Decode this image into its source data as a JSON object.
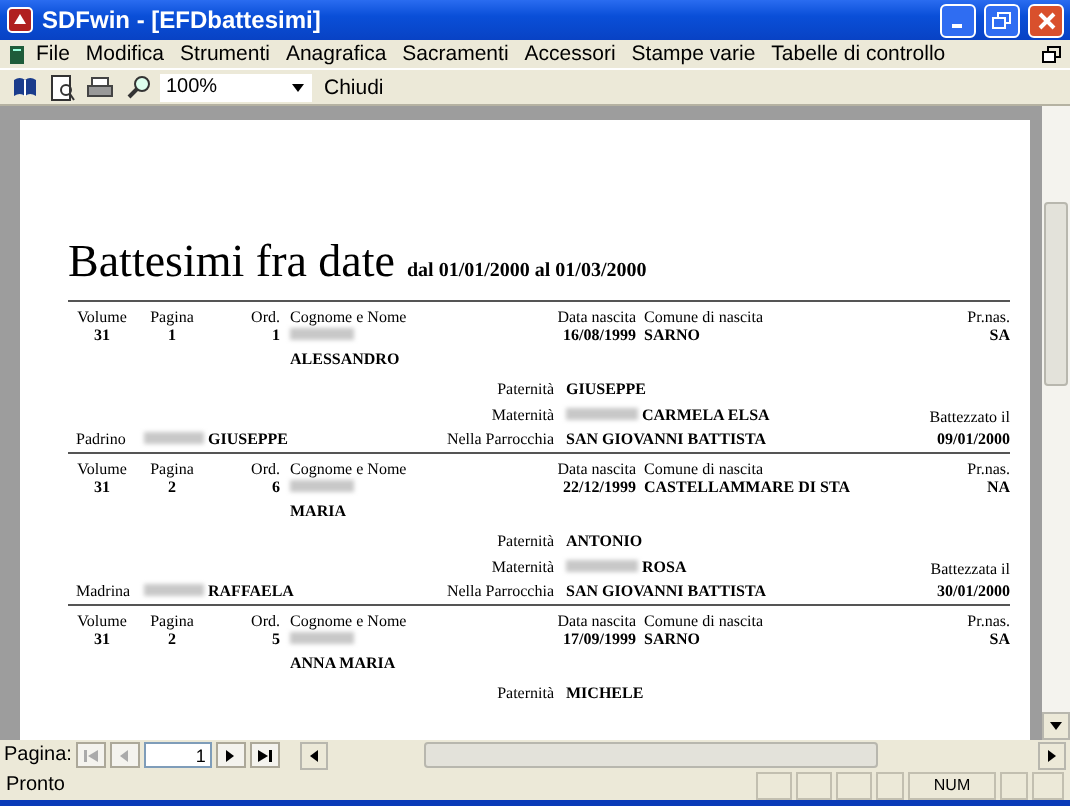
{
  "window": {
    "title": "SDFwin - [EFDbattesimi]"
  },
  "menu": [
    "File",
    "Modifica",
    "Strumenti",
    "Anagrafica",
    "Sacramenti",
    "Accessori",
    "Stampe varie",
    "Tabelle di controllo"
  ],
  "toolbar": {
    "zoom": "100%",
    "close_label": "Chiudi"
  },
  "report": {
    "title": "Battesimi fra date",
    "subtitle": "dal 01/01/2000 al 01/03/2000",
    "records": [
      {
        "volume": {
          "label": "Volume",
          "value": "31"
        },
        "page": {
          "label": "Pagina",
          "value": "1"
        },
        "ord": {
          "label": "Ord.",
          "value": "1"
        },
        "name": {
          "label": "Cognome e Nome",
          "value": "ALESSANDRO"
        },
        "birth_date": {
          "label": "Data nascita",
          "value": "16/08/1999"
        },
        "birthplace": {
          "label": "Comune di nascita",
          "value": "SARNO"
        },
        "province": {
          "label": "Pr.nas.",
          "value": "SA"
        },
        "father": {
          "label": "Paternità",
          "value": "GIUSEPPE"
        },
        "mother": {
          "label": "Maternità",
          "value": "CARMELA ELSA"
        },
        "baptism": {
          "label": "Battezzato il",
          "value": "09/01/2000"
        },
        "sponsor": {
          "label": "Padrino",
          "value": "GIUSEPPE"
        },
        "parish": {
          "label": "Nella Parrocchia",
          "value": "SAN GIOVANNI BATTISTA"
        }
      },
      {
        "volume": {
          "label": "Volume",
          "value": "31"
        },
        "page": {
          "label": "Pagina",
          "value": "2"
        },
        "ord": {
          "label": "Ord.",
          "value": "6"
        },
        "name": {
          "label": "Cognome e Nome",
          "value": "MARIA"
        },
        "birth_date": {
          "label": "Data nascita",
          "value": "22/12/1999"
        },
        "birthplace": {
          "label": "Comune di nascita",
          "value": "CASTELLAMMARE DI STA"
        },
        "province": {
          "label": "Pr.nas.",
          "value": "NA"
        },
        "father": {
          "label": "Paternità",
          "value": "ANTONIO"
        },
        "mother": {
          "label": "Maternità",
          "value": "ROSA"
        },
        "baptism": {
          "label": "Battezzata il",
          "value": "30/01/2000"
        },
        "sponsor": {
          "label": "Madrina",
          "value": "RAFFAELA"
        },
        "parish": {
          "label": "Nella Parrocchia",
          "value": "SAN GIOVANNI BATTISTA"
        }
      },
      {
        "volume": {
          "label": "Volume",
          "value": "31"
        },
        "page": {
          "label": "Pagina",
          "value": "2"
        },
        "ord": {
          "label": "Ord.",
          "value": "5"
        },
        "name": {
          "label": "Cognome e Nome",
          "value": "ANNA MARIA"
        },
        "birth_date": {
          "label": "Data nascita",
          "value": "17/09/1999"
        },
        "birthplace": {
          "label": "Comune di nascita",
          "value": "SARNO"
        },
        "province": {
          "label": "Pr.nas.",
          "value": "SA"
        },
        "father": {
          "label": "Paternità",
          "value": "MICHELE"
        }
      }
    ]
  },
  "navigation": {
    "label": "Pagina:",
    "page": "1",
    "buttons": [
      {
        "kind": "first",
        "disabled": true
      },
      {
        "kind": "prev",
        "disabled": true
      },
      {
        "kind": "next",
        "disabled": false
      },
      {
        "kind": "last",
        "disabled": false
      }
    ]
  },
  "status_bar": {
    "text": "Pronto",
    "indicators": [
      "NUM"
    ]
  }
}
